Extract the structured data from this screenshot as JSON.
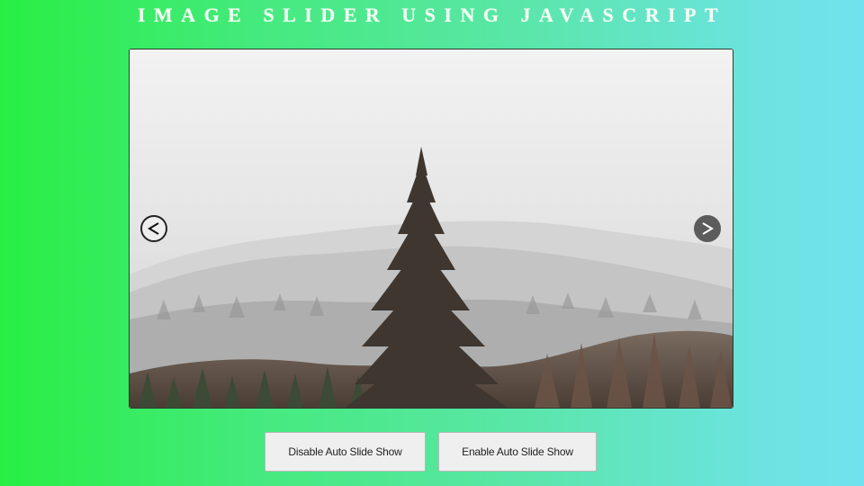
{
  "page": {
    "title": "IMAGE SLIDER USING JAVASCRIPT"
  },
  "slider": {
    "image_description": "snowy forest with a lone evergreen tree",
    "prev_icon": "chevron-left-icon",
    "next_icon": "chevron-right-icon"
  },
  "controls": {
    "disable_label": "Disable Auto Slide Show",
    "enable_label": "Enable Auto Slide Show"
  },
  "colors": {
    "gradient_left": "#28ee44",
    "gradient_right": "#70e2ee",
    "title_text": "#f4fff4",
    "button_bg": "#efefef",
    "next_button_bg": "#5c5c5c"
  }
}
